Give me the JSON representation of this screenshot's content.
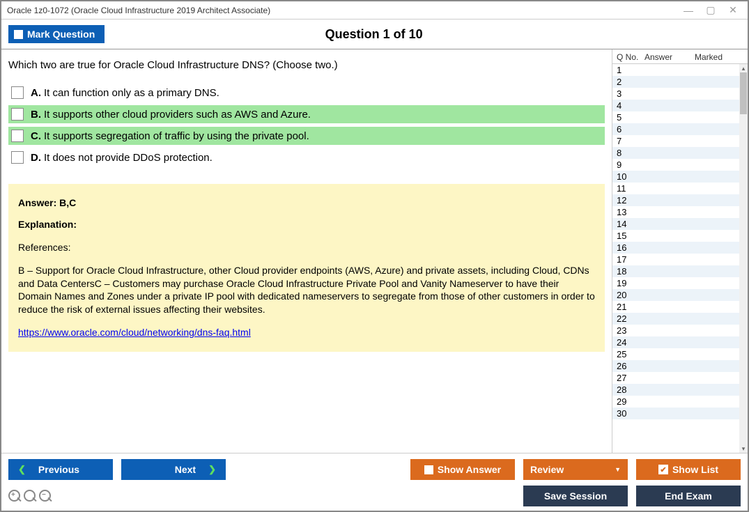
{
  "window": {
    "title": "Oracle 1z0-1072 (Oracle Cloud Infrastructure 2019 Architect Associate)"
  },
  "header": {
    "mark_label": "Mark Question",
    "heading": "Question 1 of 10"
  },
  "question": {
    "text": "Which two are true for Oracle Cloud Infrastructure DNS? (Choose two.)",
    "options": [
      {
        "letter": "A.",
        "text": "It can function only as a primary DNS.",
        "correct": false
      },
      {
        "letter": "B.",
        "text": "It supports other cloud providers such as AWS and Azure.",
        "correct": true
      },
      {
        "letter": "C.",
        "text": "It supports segregation of traffic by using the private pool.",
        "correct": true
      },
      {
        "letter": "D.",
        "text": "It does not provide DDoS protection.",
        "correct": false
      }
    ]
  },
  "answer_box": {
    "answer_label": "Answer: B,C",
    "explanation_label": "Explanation:",
    "references_label": "References:",
    "references_body": "B – Support for Oracle Cloud Infrastructure, other Cloud provider endpoints (AWS, Azure) and private assets, including Cloud, CDNs and Data CentersC – Customers may purchase Oracle Cloud Infrastructure Private Pool and Vanity Nameserver to have their Domain Names and Zones under a private IP pool with dedicated nameservers to segregate from those of other customers in order to reduce the risk of external issues affecting their websites.",
    "link_text": "https://www.oracle.com/cloud/networking/dns-faq.html"
  },
  "sidebar": {
    "headers": {
      "qno": "Q No.",
      "answer": "Answer",
      "marked": "Marked"
    },
    "rows": [
      1,
      2,
      3,
      4,
      5,
      6,
      7,
      8,
      9,
      10,
      11,
      12,
      13,
      14,
      15,
      16,
      17,
      18,
      19,
      20,
      21,
      22,
      23,
      24,
      25,
      26,
      27,
      28,
      29,
      30
    ]
  },
  "buttons": {
    "previous": "Previous",
    "next": "Next",
    "show_answer": "Show Answer",
    "review": "Review",
    "show_list": "Show List",
    "save_session": "Save Session",
    "end_exam": "End Exam"
  }
}
